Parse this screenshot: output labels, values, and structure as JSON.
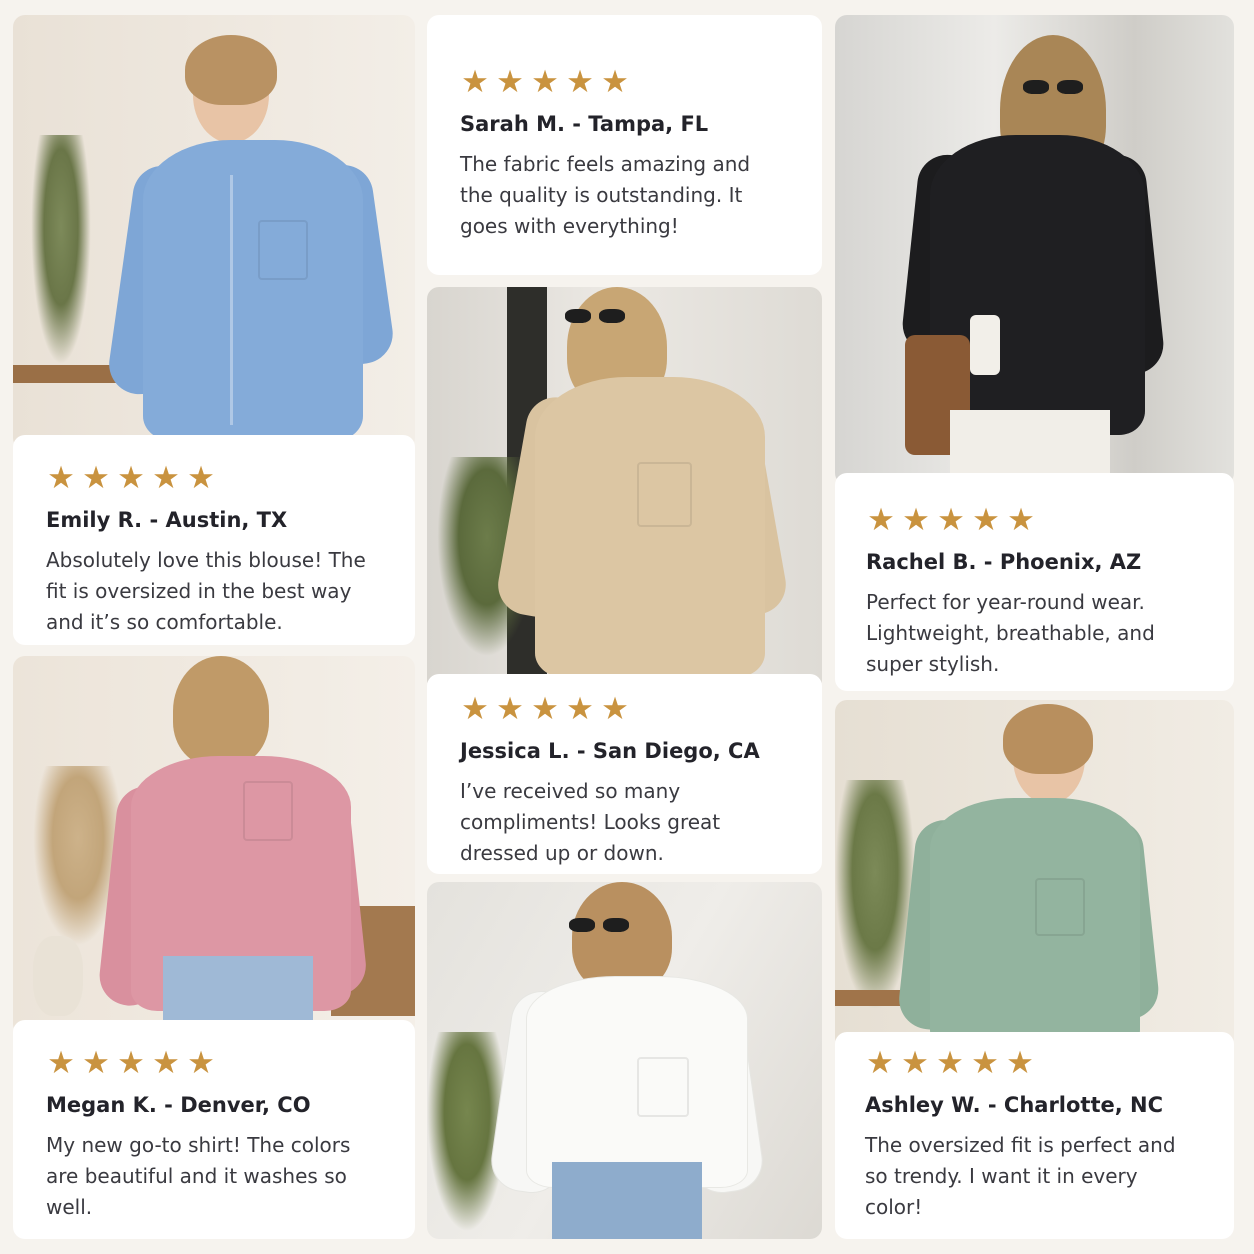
{
  "rating_symbol": "★",
  "colors": {
    "star": "#c9933f",
    "background": "#f6f3ee",
    "card": "#ffffff"
  },
  "reviews": [
    {
      "name": "Sarah M. - Tampa, FL",
      "text": "The fabric feels amazing and the quality is outstanding. It goes with everything!",
      "rating": 5
    },
    {
      "name": "Emily R. - Austin, TX",
      "text": "Absolutely love this blouse! The fit is oversized in the best way and it’s so comfortable.",
      "rating": 5
    },
    {
      "name": "Rachel B. - Phoenix, AZ",
      "text": "Perfect for year-round wear. Lightweight, breathable, and super stylish.",
      "rating": 5
    },
    {
      "name": "Jessica L. - San Diego, CA",
      "text": "I’ve received so many compliments! Looks great dressed up or down.",
      "rating": 5
    },
    {
      "name": "Megan K. - Denver, CO",
      "text": "My new go-to shirt! The colors are beautiful and it washes so well.",
      "rating": 5
    },
    {
      "name": "Ashley W. - Charlotte, NC",
      "text": "The oversized fit is perfect and so trendy. I want it in every color!",
      "rating": 5
    }
  ],
  "photos": [
    {
      "shirt_color": "blue",
      "shirt_hex": "#7ea6d6"
    },
    {
      "shirt_color": "beige",
      "shirt_hex": "#d9c3a0"
    },
    {
      "shirt_color": "black",
      "shirt_hex": "#1c1c1e"
    },
    {
      "shirt_color": "pink",
      "shirt_hex": "#d9909e"
    },
    {
      "shirt_color": "white",
      "shirt_hex": "#f7f7f5"
    },
    {
      "shirt_color": "sage green",
      "shirt_hex": "#8fb09b"
    }
  ]
}
